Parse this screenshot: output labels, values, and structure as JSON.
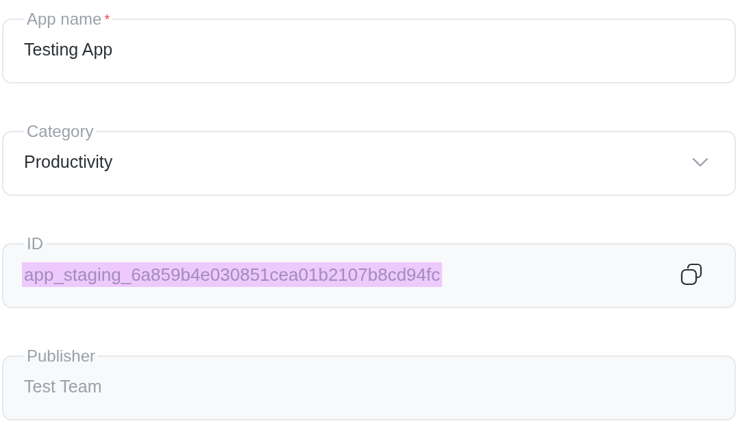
{
  "fields": [
    {
      "kind": "input",
      "label": "App name",
      "required_mark": "*",
      "value": "Testing App",
      "disabled": false
    },
    {
      "kind": "select",
      "label": "Category",
      "value": "Productivity",
      "disabled": false
    },
    {
      "kind": "copy",
      "label": "ID",
      "value": "app_staging_6a859b4e030851cea01b2107b8cd94fc",
      "disabled": true,
      "highlighted": true
    },
    {
      "kind": "input",
      "label": "Publisher",
      "value": "Test Team",
      "disabled": true
    }
  ]
}
